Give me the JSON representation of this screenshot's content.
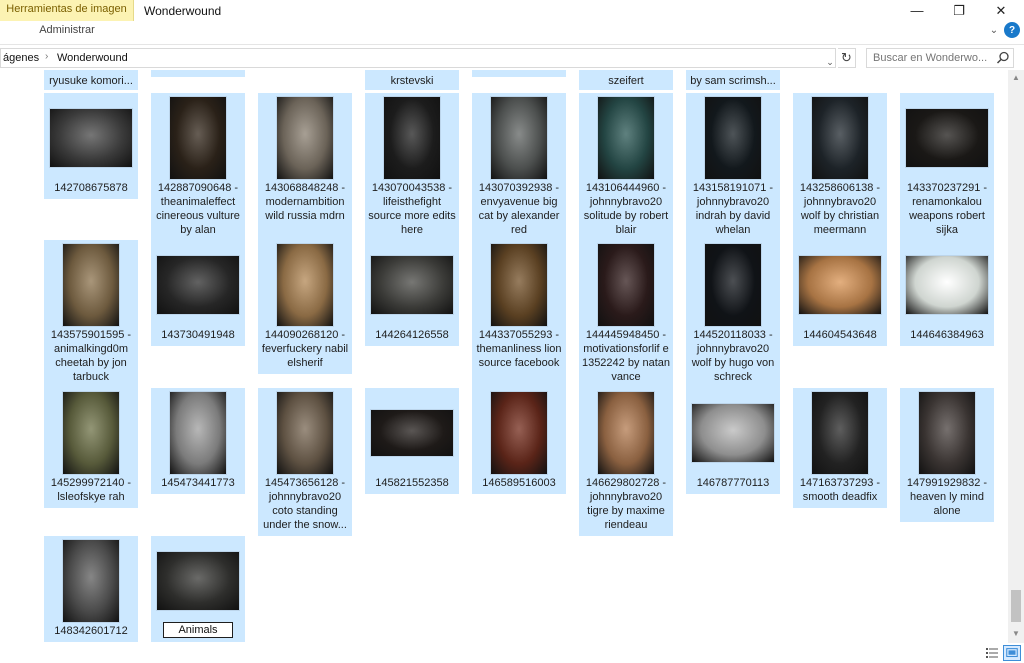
{
  "ribbon": {
    "contextual_tab": "Herramientas de imagen",
    "contextual_sub": "Administrar",
    "window_title": "Wonderwound"
  },
  "window_controls": {
    "minimize": "—",
    "maximize": "❐",
    "close": "✕",
    "expand": "⌄",
    "help": "?"
  },
  "address": {
    "crumbs": [
      "ágenes",
      "Wonderwound"
    ],
    "separator": "›",
    "dropdown": "⌄",
    "refresh": "↻",
    "search_placeholder": "Buscar en Wonderwo..."
  },
  "top_partial_items": [
    {
      "label": "ryusuke komori..."
    },
    {
      "label": ""
    },
    {
      "label": ""
    },
    {
      "label": "krstevski"
    },
    {
      "label": ""
    },
    {
      "label": "szeifert"
    },
    {
      "label": "by sam scrimsh..."
    }
  ],
  "files": [
    {
      "label": "142708675878",
      "tone": "#3a3a3a",
      "shape": "land"
    },
    {
      "label": "142887090648 - theanimaleffect cinereous vulture by alan",
      "tone": "#2a2118",
      "shape": "port"
    },
    {
      "label": "143068848248 - modernambition wild russia mdrn",
      "tone": "#6b6358",
      "shape": "port"
    },
    {
      "label": "143070043538 - lifeisthefight source more edits here",
      "tone": "#1c1c1c",
      "shape": "port"
    },
    {
      "label": "143070392938 - envyavenue big cat by alexander red",
      "tone": "#4c4f4e",
      "shape": "port"
    },
    {
      "label": "143106444960 - johnnybravo20 solitude by robert blair",
      "tone": "#234543",
      "shape": "port"
    },
    {
      "label": "143158191071 - johnnybravo20 indrah by david whelan",
      "tone": "#12181c",
      "shape": "port"
    },
    {
      "label": "143258606138 - johnnybravo20 wolf by christian meermann",
      "tone": "#1d2328",
      "shape": "port"
    },
    {
      "label": "143370237291 - renamonkalou weapons robert sijka",
      "tone": "#1a1816",
      "shape": "land"
    },
    {
      "label": "143575901595 - animalkingd0m cheetah by jon tarbuck",
      "tone": "#6d5a3e",
      "shape": "port"
    },
    {
      "label": "143730491948",
      "tone": "#262626",
      "shape": "land"
    },
    {
      "label": "144090268120 - feverfuckery nabil elsherif",
      "tone": "#8a6a44",
      "shape": "port"
    },
    {
      "label": "144264126558",
      "tone": "#3b3b38",
      "shape": "land"
    },
    {
      "label": "144337055293 - themanliness lion source facebook",
      "tone": "#5a4022",
      "shape": "port"
    },
    {
      "label": "144445948450 - motivationsforlif e 1352242 by natan vance",
      "tone": "#2a1a1a",
      "shape": "port"
    },
    {
      "label": "144520118033 - johnnybravo20 wolf by hugo von schreck",
      "tone": "#101317",
      "shape": "port"
    },
    {
      "label": "144604543648",
      "tone": "#a77343",
      "shape": "land"
    },
    {
      "label": "144646384963",
      "tone": "#cfd5d0",
      "shape": "land"
    },
    {
      "label": "145299972140 - lsleofskye rah",
      "tone": "#575a3a",
      "shape": "port"
    },
    {
      "label": "145473441773",
      "tone": "#7b7b7b",
      "shape": "port"
    },
    {
      "label": "145473656128 - johnnybravo20 coto standing under the snow...",
      "tone": "#5e5142",
      "shape": "port"
    },
    {
      "label": "145821552358",
      "tone": "#1e1a18",
      "shape": "wide"
    },
    {
      "label": "146589516003",
      "tone": "#5a2418",
      "shape": "port"
    },
    {
      "label": "146629802728 - johnnybravo20 tigre by maxime riendeau",
      "tone": "#8a6040",
      "shape": "port"
    },
    {
      "label": "146787770113",
      "tone": "#8e8e8e",
      "shape": "land"
    },
    {
      "label": "147163737293 - smooth deadfix",
      "tone": "#222",
      "shape": "port"
    },
    {
      "label": "147991929832 - heaven ly mind alone",
      "tone": "#3a3432",
      "shape": "port"
    },
    {
      "label": "148342601712",
      "tone": "#4a4a4a",
      "shape": "port"
    },
    {
      "label": "",
      "tone": "#2e2e2c",
      "shape": "land",
      "renaming": true
    }
  ],
  "rename_value": "Animals"
}
